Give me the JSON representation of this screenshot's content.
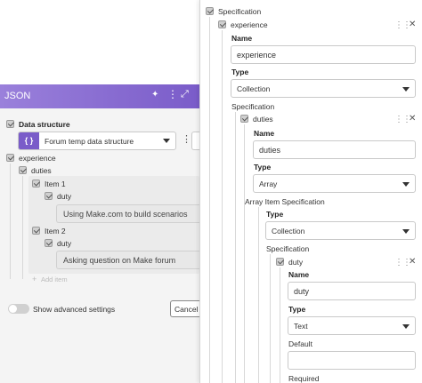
{
  "left": {
    "header_title": "JSON",
    "data_structure_label": "Data structure",
    "data_structure_value": "Forum temp data structure",
    "tree": {
      "root": "experience",
      "child": "duties",
      "item1": "Item 1",
      "item1_field": "duty",
      "item1_value": "Using Make.com to build scenarios",
      "item2": "Item 2",
      "item2_field": "duty",
      "item2_value": "Asking question on Make forum",
      "add_item": "Add item"
    },
    "advanced_toggle_label": "Show advanced settings",
    "cancel_label": "Cancel"
  },
  "right": {
    "spec_label": "Specification",
    "experience_node": "experience",
    "name_label": "Name",
    "name_value": "experience",
    "type_label": "Type",
    "type_value": "Collection",
    "spec2_label": "Specification",
    "duties_node": "duties",
    "duties_name_label": "Name",
    "duties_name_value": "duties",
    "duties_type_label": "Type",
    "duties_type_value": "Array",
    "array_item_spec_label": "Array Item Specification",
    "ai_type_label": "Type",
    "ai_type_value": "Collection",
    "spec3_label": "Specification",
    "duty_node": "duty",
    "duty_name_label": "Name",
    "duty_name_value": "duty",
    "duty_type_label": "Type",
    "duty_type_value": "Text",
    "default_label": "Default",
    "default_value": "",
    "required_label": "Required"
  },
  "colors": {
    "header_purple": "#8b6fd1",
    "header_purple_dark": "#7a5cc9",
    "left_bg": "#f3f3f3"
  }
}
